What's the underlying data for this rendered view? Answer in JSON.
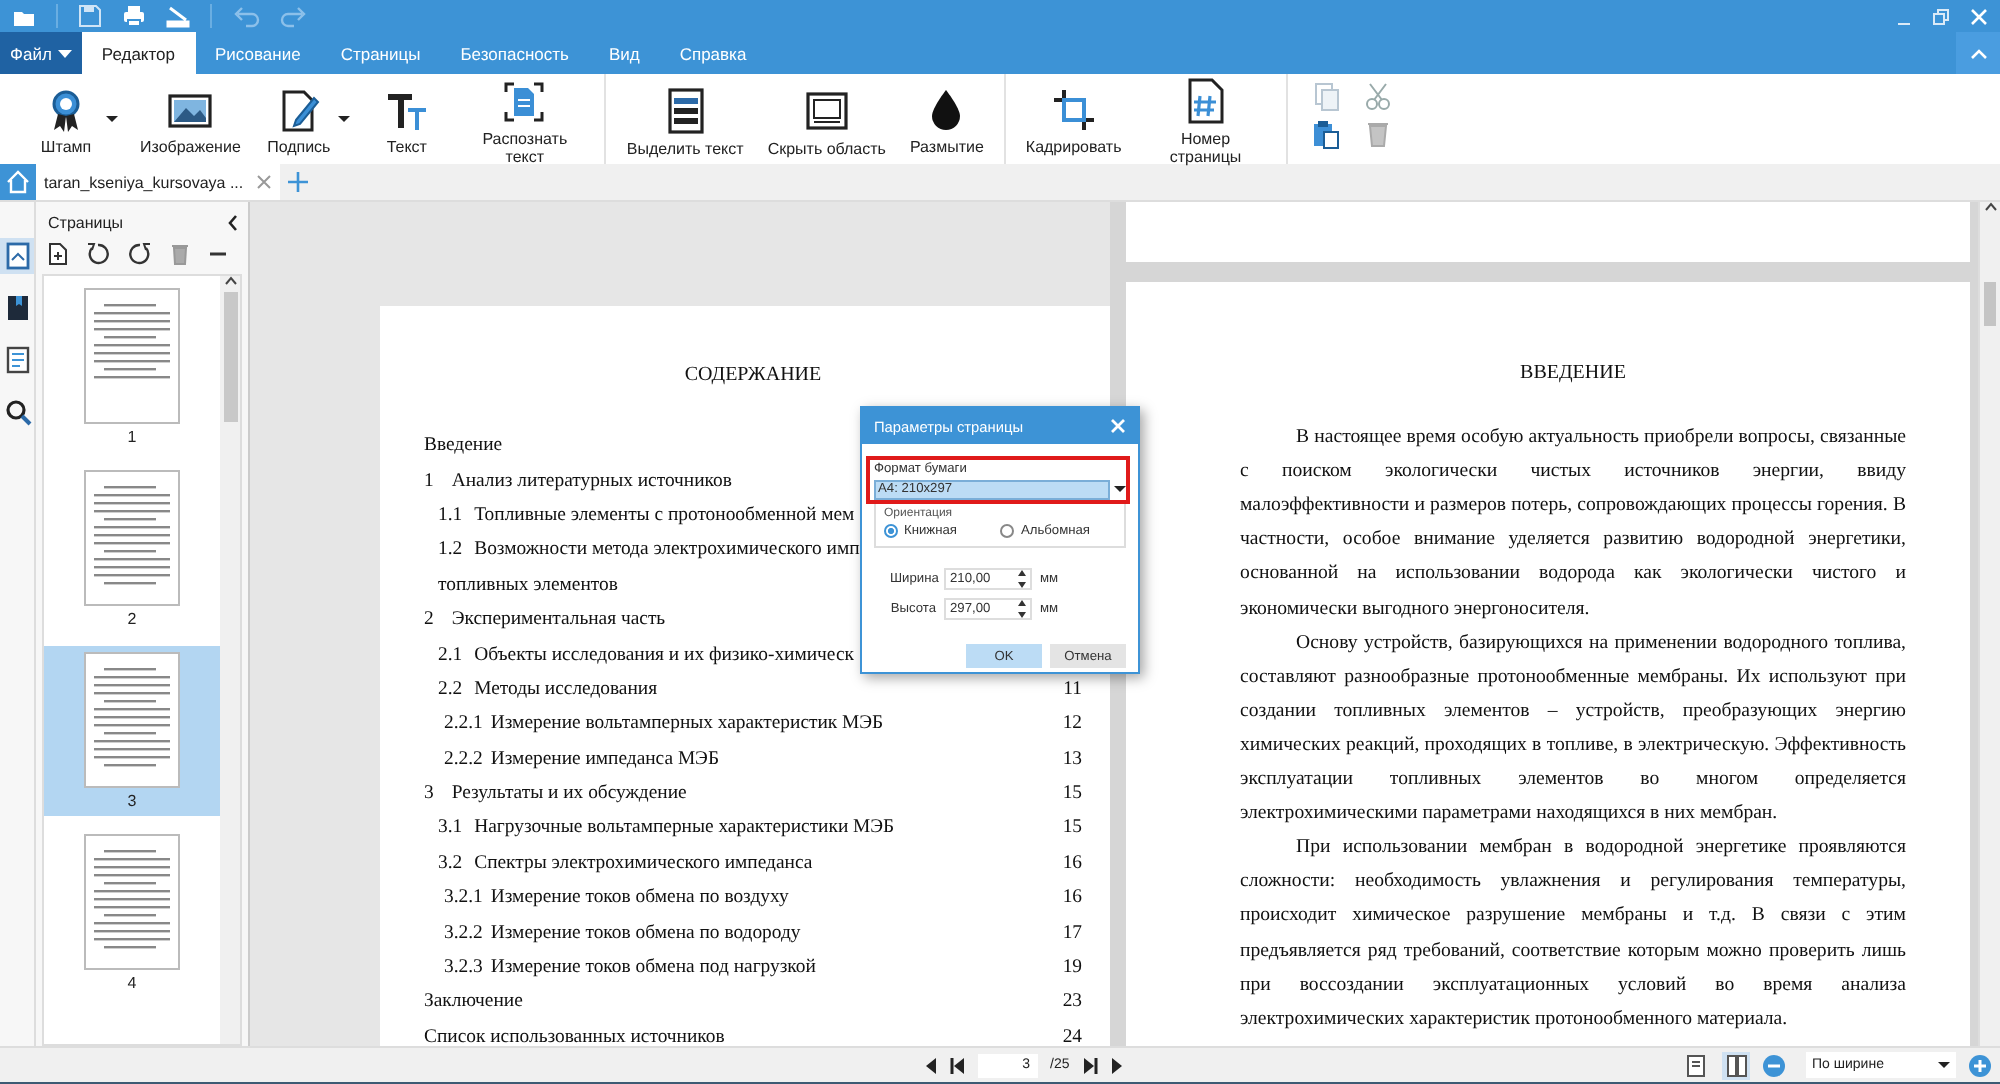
{
  "menu_tabs": [
    {
      "label": "Файл",
      "kind": "file",
      "selected": false
    },
    {
      "label": "Редактор",
      "kind": "tab",
      "selected": true
    },
    {
      "label": "Рисование",
      "kind": "tab",
      "selected": false
    },
    {
      "label": "Страницы",
      "kind": "tab",
      "selected": false
    },
    {
      "label": "Безопасность",
      "kind": "tab",
      "selected": false
    },
    {
      "label": "Вид",
      "kind": "tab",
      "selected": false
    },
    {
      "label": "Справка",
      "kind": "tab",
      "selected": false
    }
  ],
  "ribbon_groups": [
    [
      {
        "label": "Штамп",
        "has_menu": true
      },
      {
        "label": "Изображение",
        "has_menu": false
      },
      {
        "label": "Подпись",
        "has_menu": true
      },
      {
        "label": "Текст",
        "has_menu": false
      },
      {
        "label": "Распознать текст",
        "has_menu": false
      }
    ],
    [
      {
        "label": "Выделить текст",
        "has_menu": false
      },
      {
        "label": "Скрыть область",
        "has_menu": false
      },
      {
        "label": "Размытие",
        "has_menu": false
      }
    ],
    [
      {
        "label": "Кадрировать",
        "has_menu": false
      },
      {
        "label": "Номер страницы",
        "has_menu": false
      }
    ]
  ],
  "document_tab": {
    "label": "taran_kseniya_kursovaya ...",
    "selected": true
  },
  "side_rail": [
    {
      "selected": true
    },
    {
      "selected": false
    },
    {
      "selected": false
    },
    {
      "selected": false
    }
  ],
  "pages_panel": {
    "title": "Страницы",
    "thumbnails": [
      {
        "label": "1",
        "selected": false
      },
      {
        "label": "2",
        "selected": false
      },
      {
        "label": "3",
        "selected": true
      },
      {
        "label": "4",
        "selected": false
      }
    ]
  },
  "left_page": {
    "heading": "СОДЕРЖАНИЕ",
    "toc": [
      {
        "text": "Введение"
      },
      {
        "number": "1",
        "text": "Анализ литературных источников",
        "children": [
          {
            "number": "1.1",
            "text": "Топливные элементы с протонообменной мем"
          },
          {
            "number": "1.2",
            "text": "Возможности метода электрохимического имп",
            "text_line_2": "топливных элементов"
          }
        ]
      },
      {
        "number": "2",
        "text": "Экспериментальная часть",
        "children": [
          {
            "number": "2.1",
            "text": "Объекты исследования и их физико-химическ"
          },
          {
            "number": "2.2",
            "text": "Методы исследования",
            "page": "11",
            "children": [
              {
                "number": "2.2.1",
                "text": "Измерение вольтамперных характеристик МЭБ",
                "page": "12"
              },
              {
                "number": "2.2.2",
                "text": "Измерение импеданса МЭБ",
                "page": "13"
              }
            ]
          }
        ]
      },
      {
        "number": "3",
        "text": "Результаты и их обсуждение",
        "page": "15",
        "children": [
          {
            "number": "3.1",
            "text": "Нагрузочные вольтамперные характеристики МЭБ",
            "page": "15"
          },
          {
            "number": "3.2",
            "text": "Спектры электрохимического импеданса",
            "page": "16",
            "children": [
              {
                "number": "3.2.1",
                "text": "Измерение токов обмена по воздуху",
                "page": "16"
              },
              {
                "number": "3.2.2",
                "text": "Измерение токов обмена по водороду",
                "page": "17"
              },
              {
                "number": "3.2.3",
                "text": "Измерение токов обмена под нагрузкой",
                "page": "19"
              }
            ]
          }
        ]
      },
      {
        "text": "Заключение",
        "page": "23"
      },
      {
        "text": "Список использованных источников",
        "page": "24"
      }
    ]
  },
  "right_page": {
    "heading": "ВВЕДЕНИЕ",
    "paragraphs": [
      "В настоящее время особую актуальность приобрели вопросы, связанные с поиском экологически чистых источников энергии, ввиду малоэффективности и размеров потерь, сопровождающих процессы горения. В частности, особое внимание уделяется развитию водородной энергетики, основанной на использовании водорода как экологически чистого и экономически выгодного энергоносителя.",
      "Основу устройств, базирующихся на применении водородного топлива, составляют разнообразные протонообменные мембраны. Их используют при создании топливных элементов – устройств, преобразующих энергию химических реакций, проходящих в топливе, в электрическую. Эффективность эксплуатации топливных элементов во многом определяется электрохимическими параметрами находящихся в них мембран.",
      "При использовании мембран в водородной энергетике проявляются сложности: необходимость увлажнения и регулирования температуры, происходит химическое разрушение мембраны и т.д. В связи с этим предъявляется ряд требований, соответствие которым можно проверить лишь при воссоздании эксплуатационных условий во время анализа электрохимических характеристик протонообменного материала."
    ]
  },
  "dialog": {
    "title": "Параметры страницы",
    "paper_label": "Формат бумаги",
    "paper_value": "A4: 210x297",
    "orientation_label": "Ориентация",
    "orientations": [
      {
        "label": "Книжная",
        "selected": true
      },
      {
        "label": "Альбомная",
        "selected": false
      }
    ],
    "fields": [
      {
        "label": "Ширина",
        "value": "210,00",
        "unit": "мм"
      },
      {
        "label": "Высота",
        "value": "297,00",
        "unit": "мм"
      }
    ],
    "buttons": [
      {
        "label": "OK",
        "kind": "primary"
      },
      {
        "label": "Отмена",
        "kind": "secondary"
      }
    ]
  },
  "status_bar": {
    "page": "3",
    "page_count": "/25",
    "views": [
      {
        "selected": false
      },
      {
        "selected": true
      }
    ],
    "zoom": "По ширине"
  }
}
